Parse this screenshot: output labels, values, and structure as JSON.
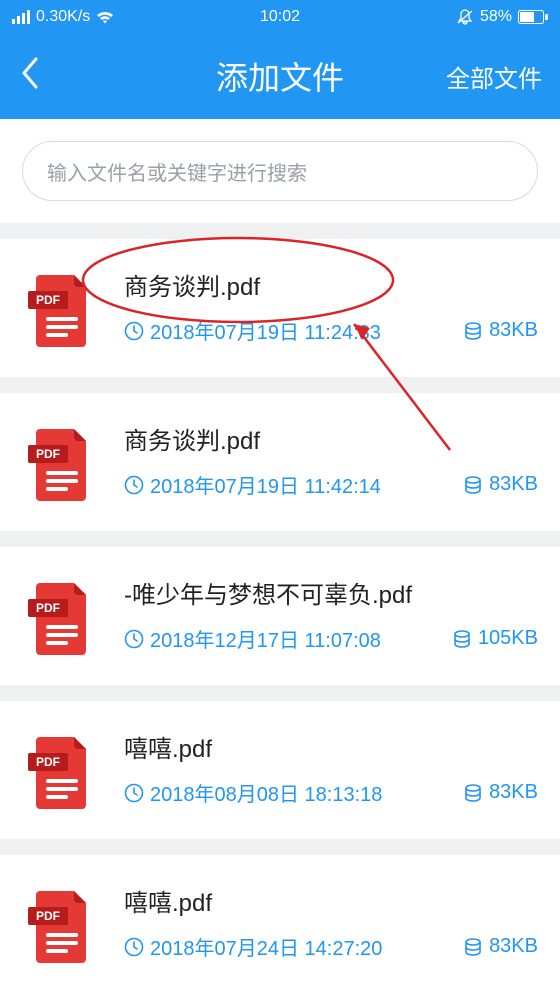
{
  "status": {
    "net_speed": "0.30K/s",
    "time": "10:02",
    "battery_pct": "58%"
  },
  "header": {
    "title": "添加文件",
    "right_label": "全部文件"
  },
  "search": {
    "placeholder": "输入文件名或关键字进行搜索"
  },
  "files": [
    {
      "name": "商务谈判.pdf",
      "date": "2018年07月19日 11:24:33",
      "size": "83KB"
    },
    {
      "name": "商务谈判.pdf",
      "date": "2018年07月19日 11:42:14",
      "size": "83KB"
    },
    {
      "name": "-唯少年与梦想不可辜负.pdf",
      "date": "2018年12月17日 11:07:08",
      "size": "105KB"
    },
    {
      "name": "嘻嘻.pdf",
      "date": "2018年08月08日 18:13:18",
      "size": "83KB"
    },
    {
      "name": "嘻嘻.pdf",
      "date": "2018年07月24日 14:27:20",
      "size": "83KB"
    }
  ],
  "colors": {
    "accent": "#2196f3",
    "pdf_red": "#e53935",
    "pdf_dark": "#b71c1c",
    "annotation": "#d9252a"
  }
}
